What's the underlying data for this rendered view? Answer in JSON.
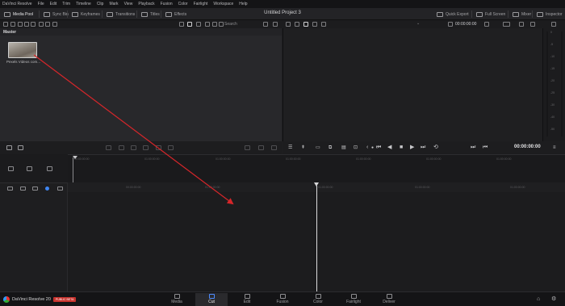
{
  "menu": [
    "DaVinci Resolve",
    "File",
    "Edit",
    "Trim",
    "Timeline",
    "Clip",
    "Mark",
    "View",
    "Playback",
    "Fusion",
    "Color",
    "Fairlight",
    "Workspace",
    "Help"
  ],
  "toolbar": {
    "media_pool": "Media Pool",
    "sync_bin": "Sync Bin",
    "keyframes": "Keyframes",
    "transitions": "Transitions",
    "titles": "Titles",
    "effects": "Effects",
    "quick_export": "Quick Export",
    "full_screen": "Full Screen",
    "mixer": "Mixer",
    "inspector": "Inspector"
  },
  "project_title": "Untitled Project 3",
  "media_pool": {
    "search_placeholder": "Search",
    "bin": "Master",
    "clip_name": "Pexels Videos com..."
  },
  "viewer": {
    "source_timecode": "00:00:00:00"
  },
  "transport": {
    "timecode": "00:00:00:00"
  },
  "meters": {
    "ticks": [
      "0",
      "-5",
      "-10",
      "-15",
      "-20",
      "-25",
      "-30",
      "-40",
      "-50"
    ]
  },
  "upper_ruler": [
    "00:00:00:00",
    "01:00:00:00",
    "01:00:00:00",
    "01:00:00:00",
    "01:00:00:00",
    "01:00:00:00",
    "01:00:00:00"
  ],
  "lower_ruler": [
    "00:00:00:00",
    "01:00:00:00",
    "01:00:00:00",
    "01:00:00:00",
    "01:00:00:00"
  ],
  "pages": [
    "Media",
    "Cut",
    "Edit",
    "Fusion",
    "Color",
    "Fairlight",
    "Deliver"
  ],
  "active_page": "Cut",
  "brand": {
    "name": "DaVinci Resolve 20",
    "badge": "PUBLIC BETA"
  },
  "annotation": {
    "color": "#d6262a"
  }
}
